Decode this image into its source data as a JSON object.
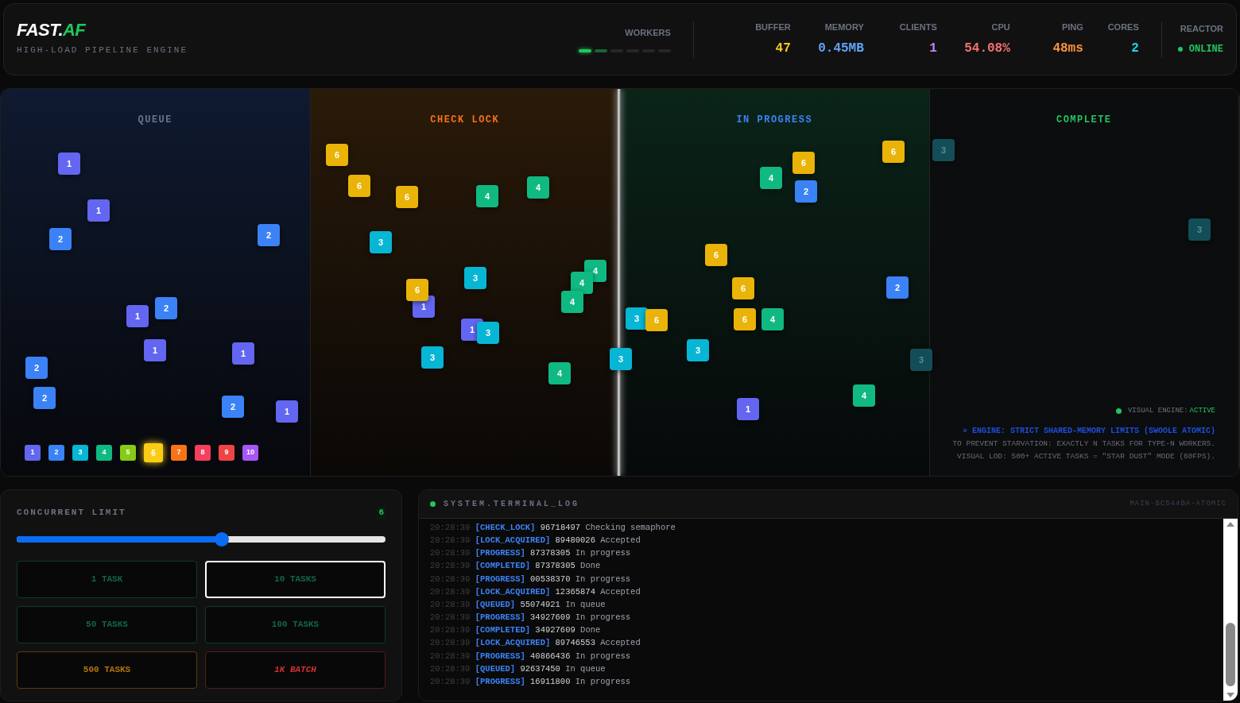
{
  "header": {
    "logo": {
      "text": "FAST.",
      "accent": "AF"
    },
    "subtitle": "HIGH-LOAD PIPELINE ENGINE",
    "workers": {
      "label": "WORKERS",
      "slots": [
        {
          "active": true
        },
        {
          "active": true
        },
        {
          "active": false
        },
        {
          "active": false
        },
        {
          "active": false
        },
        {
          "active": false
        }
      ]
    },
    "stats": [
      {
        "label": "BUFFER",
        "value": "47",
        "color": "#facc15"
      },
      {
        "label": "MEMORY",
        "value": "0.45MB",
        "color": "#60a5fa"
      },
      {
        "label": "CLIENTS",
        "value": "1",
        "color": "#c084fc"
      },
      {
        "label": "CPU",
        "value": "54.08%",
        "color": "#f87171"
      },
      {
        "label": "PING",
        "value": "48ms",
        "color": "#fb923c"
      },
      {
        "label": "CORES",
        "value": "2",
        "color": "#22d3ee"
      }
    ],
    "reactor": {
      "label": "REACTOR",
      "status": "ONLINE",
      "on": true
    }
  },
  "board": {
    "lanes": [
      {
        "title": "QUEUE",
        "kind": "queue",
        "tasks": [
          {
            "label": "1",
            "color": "#6366f1",
            "faded": false
          },
          {
            "label": "1",
            "color": "#6366f1",
            "faded": false
          },
          {
            "label": "2",
            "color": "#3b82f6",
            "faded": false
          },
          {
            "label": "2",
            "color": "#3b82f6",
            "faded": false
          },
          {
            "label": "1",
            "color": "#6366f1",
            "faded": false
          },
          {
            "label": "2",
            "color": "#3b82f6",
            "faded": false
          },
          {
            "label": "1",
            "color": "#6366f1",
            "faded": false
          },
          {
            "label": "1",
            "color": "#6366f1",
            "faded": false
          },
          {
            "label": "2",
            "color": "#3b82f6",
            "faded": false
          },
          {
            "label": "2",
            "color": "#3b82f6",
            "faded": false
          },
          {
            "label": "2",
            "color": "#3b82f6",
            "faded": false
          },
          {
            "label": "1",
            "color": "#6366f1",
            "faded": false
          }
        ]
      },
      {
        "title": "CHECK LOCK",
        "kind": "lock",
        "tasks": [
          {
            "label": "6",
            "color": "#eab308",
            "faded": false
          },
          {
            "label": "6",
            "color": "#eab308",
            "faded": false
          },
          {
            "label": "6",
            "color": "#eab308",
            "faded": false
          },
          {
            "label": "4",
            "color": "#10b981",
            "faded": false
          },
          {
            "label": "4",
            "color": "#10b981",
            "faded": false
          },
          {
            "label": "3",
            "color": "#06b6d4",
            "faded": false
          },
          {
            "label": "3",
            "color": "#06b6d4",
            "faded": false
          },
          {
            "label": "1",
            "color": "#6366f1",
            "faded": false
          },
          {
            "label": "6",
            "color": "#eab308",
            "faded": false
          },
          {
            "label": "4",
            "color": "#10b981",
            "faded": false
          },
          {
            "label": "4",
            "color": "#10b981",
            "faded": false
          },
          {
            "label": "4",
            "color": "#10b981",
            "faded": false
          },
          {
            "label": "1",
            "color": "#6366f1",
            "faded": false
          },
          {
            "label": "3",
            "color": "#06b6d4",
            "faded": false
          },
          {
            "label": "3",
            "color": "#06b6d4",
            "faded": false
          },
          {
            "label": "4",
            "color": "#10b981",
            "faded": false
          },
          {
            "label": "3",
            "color": "#06b6d4",
            "faded": false
          }
        ]
      },
      {
        "title": "IN PROGRESS",
        "kind": "progress",
        "tasks": [
          {
            "label": "6",
            "color": "#eab308",
            "faded": false
          },
          {
            "label": "6",
            "color": "#eab308",
            "faded": false
          },
          {
            "label": "4",
            "color": "#10b981",
            "faded": false
          },
          {
            "label": "2",
            "color": "#3b82f6",
            "faded": false
          },
          {
            "label": "6",
            "color": "#eab308",
            "faded": false
          },
          {
            "label": "6",
            "color": "#eab308",
            "faded": false
          },
          {
            "label": "2",
            "color": "#3b82f6",
            "faded": false
          },
          {
            "label": "3",
            "color": "#06b6d4",
            "faded": false
          },
          {
            "label": "6",
            "color": "#eab308",
            "faded": false
          },
          {
            "label": "6",
            "color": "#eab308",
            "faded": false
          },
          {
            "label": "4",
            "color": "#10b981",
            "faded": false
          },
          {
            "label": "3",
            "color": "#06b6d4",
            "faded": false
          },
          {
            "label": "4",
            "color": "#10b981",
            "faded": false
          },
          {
            "label": "1",
            "color": "#6366f1",
            "faded": false
          }
        ]
      },
      {
        "title": "COMPLETE",
        "kind": "complete",
        "tasks": [
          {
            "label": "3",
            "color": "#134e58",
            "faded": true
          },
          {
            "label": "3",
            "color": "#134e58",
            "faded": true
          },
          {
            "label": "3",
            "color": "#134e58",
            "faded": true
          }
        ]
      }
    ],
    "legend": [
      {
        "label": "1",
        "color": "#6366f1",
        "selected": false
      },
      {
        "label": "2",
        "color": "#3b82f6",
        "selected": false
      },
      {
        "label": "3",
        "color": "#06b6d4",
        "selected": false
      },
      {
        "label": "4",
        "color": "#10b981",
        "selected": false
      },
      {
        "label": "5",
        "color": "#84cc16",
        "selected": false
      },
      {
        "label": "6",
        "color": "#facc15",
        "selected": true
      },
      {
        "label": "7",
        "color": "#f97316",
        "selected": false
      },
      {
        "label": "8",
        "color": "#f43f5e",
        "selected": false
      },
      {
        "label": "9",
        "color": "#ef4444",
        "selected": false
      },
      {
        "label": "10",
        "color": "#a855f7",
        "selected": false
      }
    ],
    "engine": {
      "label": "VISUAL ENGINE:",
      "status": "ACTIVE",
      "on": true
    },
    "notes": [
      "» ENGINE: STRICT SHARED-MEMORY LIMITS (SWOOLE ATOMIC)",
      "TO PREVENT STARVATION: EXACTLY N TASKS FOR TYPE-N WORKERS.",
      "VISUAL LOD: 500+ ACTIVE TASKS = \"STAR DUST\" MODE (60FPS)."
    ]
  },
  "limit": {
    "title": "CONCURRENT LIMIT",
    "value": "6",
    "level": 0.555,
    "buttons": [
      {
        "label": "1 TASK",
        "kind": "normal",
        "selected": false
      },
      {
        "label": "10 TASKS",
        "kind": "normal",
        "selected": true
      },
      {
        "label": "50 TASKS",
        "kind": "normal",
        "selected": false
      },
      {
        "label": "100 TASKS",
        "kind": "normal",
        "selected": false
      },
      {
        "label": "500 TASKS",
        "kind": "warn",
        "selected": false
      },
      {
        "label": "1K BATCH",
        "kind": "danger",
        "selected": false
      }
    ]
  },
  "terminal": {
    "title": "SYSTEM.TERMINAL_LOG",
    "id": "MAIN-BC544BA-ATOMIC",
    "live": true,
    "lines": [
      {
        "time": "20:28:39",
        "tag": "[CHECK_LOCK]",
        "task": "96718497",
        "message": "Checking semaphore"
      },
      {
        "time": "20:28:39",
        "tag": "[LOCK_ACQUIRED]",
        "task": "89480026",
        "message": "Accepted"
      },
      {
        "time": "20:28:39",
        "tag": "[PROGRESS]",
        "task": "87378305",
        "message": "In progress"
      },
      {
        "time": "20:28:39",
        "tag": "[COMPLETED]",
        "task": "87378305",
        "message": "Done"
      },
      {
        "time": "20:28:39",
        "tag": "[PROGRESS]",
        "task": "00538370",
        "message": "In progress"
      },
      {
        "time": "20:28:39",
        "tag": "[LOCK_ACQUIRED]",
        "task": "12365874",
        "message": "Accepted"
      },
      {
        "time": "20:28:39",
        "tag": "[QUEUED]",
        "task": "55074921",
        "message": "In queue"
      },
      {
        "time": "20:28:39",
        "tag": "[PROGRESS]",
        "task": "34927609",
        "message": "In progress"
      },
      {
        "time": "20:28:39",
        "tag": "[COMPLETED]",
        "task": "34927609",
        "message": "Done"
      },
      {
        "time": "20:28:39",
        "tag": "[LOCK_ACQUIRED]",
        "task": "89746553",
        "message": "Accepted"
      },
      {
        "time": "20:28:39",
        "tag": "[PROGRESS]",
        "task": "40866436",
        "message": "In progress"
      },
      {
        "time": "20:28:39",
        "tag": "[QUEUED]",
        "task": "92637450",
        "message": "In queue"
      },
      {
        "time": "20:28:39",
        "tag": "[PROGRESS]",
        "task": "16911800",
        "message": "In progress"
      }
    ]
  }
}
